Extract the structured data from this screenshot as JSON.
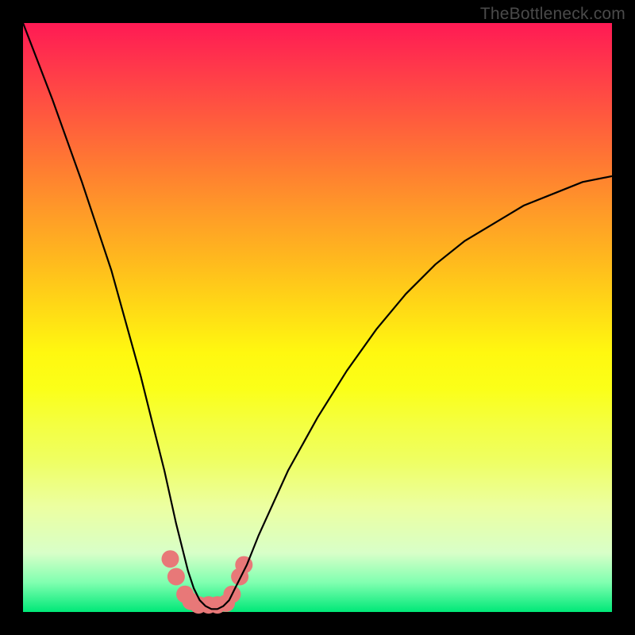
{
  "watermark": "TheBottleneck.com",
  "chart_data": {
    "type": "line",
    "title": "",
    "xlabel": "",
    "ylabel": "",
    "xlim": [
      0,
      100
    ],
    "ylim": [
      0,
      100
    ],
    "x": [
      0,
      5,
      10,
      15,
      20,
      22,
      24,
      26,
      28,
      29,
      30,
      31,
      32,
      33,
      34,
      35,
      36,
      38,
      40,
      45,
      50,
      55,
      60,
      65,
      70,
      75,
      80,
      85,
      90,
      95,
      100
    ],
    "y": [
      100,
      87,
      73,
      58,
      40,
      32,
      24,
      15,
      7,
      4,
      2,
      1,
      0.5,
      0.5,
      1,
      2,
      4,
      8,
      13,
      24,
      33,
      41,
      48,
      54,
      59,
      63,
      66,
      69,
      71,
      73,
      74
    ],
    "markers": {
      "description": "salmon-colored marker dots near curve minimum",
      "positions": [
        {
          "x": 25.0,
          "y": 9.0
        },
        {
          "x": 26.0,
          "y": 6.0
        },
        {
          "x": 27.5,
          "y": 3.0
        },
        {
          "x": 28.5,
          "y": 1.8
        },
        {
          "x": 29.8,
          "y": 1.2
        },
        {
          "x": 31.5,
          "y": 1.2
        },
        {
          "x": 33.0,
          "y": 1.2
        },
        {
          "x": 34.5,
          "y": 1.5
        },
        {
          "x": 35.5,
          "y": 3.0
        },
        {
          "x": 36.8,
          "y": 6.0
        },
        {
          "x": 37.5,
          "y": 8.0
        }
      ],
      "color": "#e87878",
      "radius": 11
    },
    "curve_color": "#000000",
    "curve_width": 2.2,
    "background_gradient": {
      "top": "#ff1a54",
      "middle": "#fff810",
      "bottom": "#00e878"
    }
  }
}
